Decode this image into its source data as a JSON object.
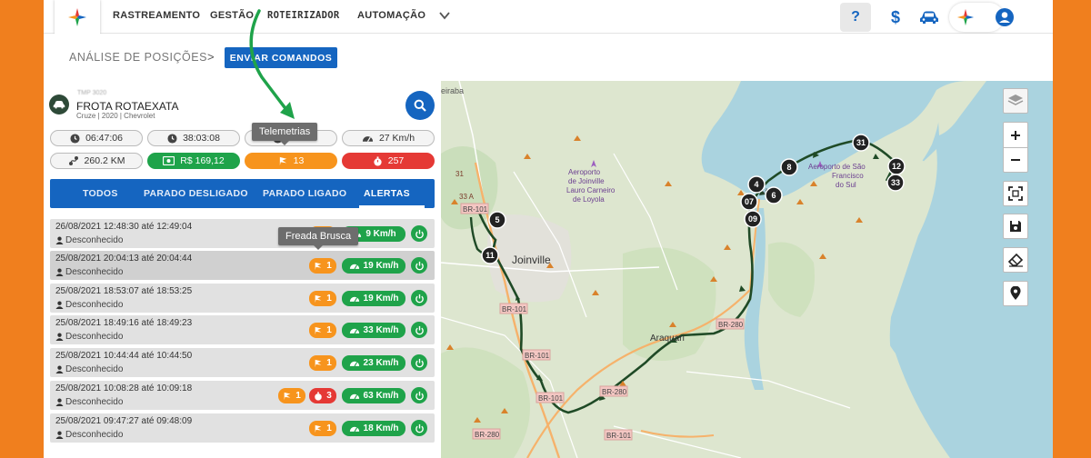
{
  "nav": {
    "items": [
      "RASTREAMENTO",
      "GESTÃO",
      "ROTEIRIZADOR",
      "AUTOMAÇÃO"
    ],
    "help": "?",
    "dollar": "$"
  },
  "breadcrumb": {
    "title": "ANÁLISE DE POSIÇÕES",
    "sep": ">",
    "button": "ENVIAR COMANDOS"
  },
  "vehicle": {
    "plate": "TMP 3020",
    "name": "FROTA ROTAEXATA",
    "sub": "Cruze | 2020 | Chevrolet"
  },
  "stats": {
    "time1": "06:47:06",
    "time2": "38:03:08",
    "time3": "10:...",
    "speed": "27 Km/h",
    "distance": "260.2 KM",
    "money": "R$ 169,12",
    "telemetry": "13",
    "alarms": "257"
  },
  "tooltips": {
    "telemetrias": "Telemetrias",
    "freada": "Freada Brusca"
  },
  "tabs": [
    "TODOS",
    "PARADO DESLIGADO",
    "PARADO LIGADO",
    "ALERTAS"
  ],
  "rows": [
    {
      "time": "26/08/2021 12:48:30 até 12:49:04",
      "driver": "Desconhecido",
      "count": "1",
      "speed": "9 Km/h"
    },
    {
      "time": "25/08/2021 20:04:13 até 20:04:44",
      "driver": "Desconhecido",
      "count": "1",
      "speed": "19 Km/h"
    },
    {
      "time": "25/08/2021 18:53:07 até 18:53:25",
      "driver": "Desconhecido",
      "count": "1",
      "speed": "19 Km/h"
    },
    {
      "time": "25/08/2021 18:49:16 até 18:49:23",
      "driver": "Desconhecido",
      "count": "1",
      "speed": "33 Km/h"
    },
    {
      "time": "25/08/2021 10:44:44 até 10:44:50",
      "driver": "Desconhecido",
      "count": "1",
      "speed": "23 Km/h"
    },
    {
      "time": "25/08/2021 10:08:28 até 10:09:18",
      "driver": "Desconhecido",
      "count": "1",
      "count2": "3",
      "speed": "63 Km/h"
    },
    {
      "time": "25/08/2021 09:47:27 até 09:48:09",
      "driver": "Desconhecido",
      "count": "1",
      "speed": "18 Km/h"
    }
  ],
  "map": {
    "labels": {
      "joinville": "Joinville",
      "araquari": "Araquari",
      "airport": [
        "Aeroporto",
        "de Joinville",
        "Lauro Carneiro",
        "de Loyola"
      ],
      "sfs": [
        "do Sul",
        "São",
        "Francisco",
        "do Sul"
      ],
      "sfs_title": "Aeroporto de São",
      "sao": "São",
      "itaum": "Itaipa",
      "br101a": "BR-101",
      "br101b": "BR-101",
      "br101c": "BR-101",
      "br101d": "BR-101",
      "br101e": "BR-101",
      "br280a": "BR-280",
      "br280b": "BR-280",
      "br280c": "BR-280",
      "r33a": "33 A",
      "r31": "31",
      "r8": "8",
      "grf": "eiraba"
    },
    "markers": [
      "5",
      "11",
      "4",
      "8",
      "6",
      "07",
      "09",
      "31",
      "12",
      "33"
    ]
  },
  "colors": {
    "accent": "#1565c0",
    "green": "#1fa34a",
    "orange": "#f7941d",
    "red": "#e53935",
    "route": "#1f4a26"
  }
}
